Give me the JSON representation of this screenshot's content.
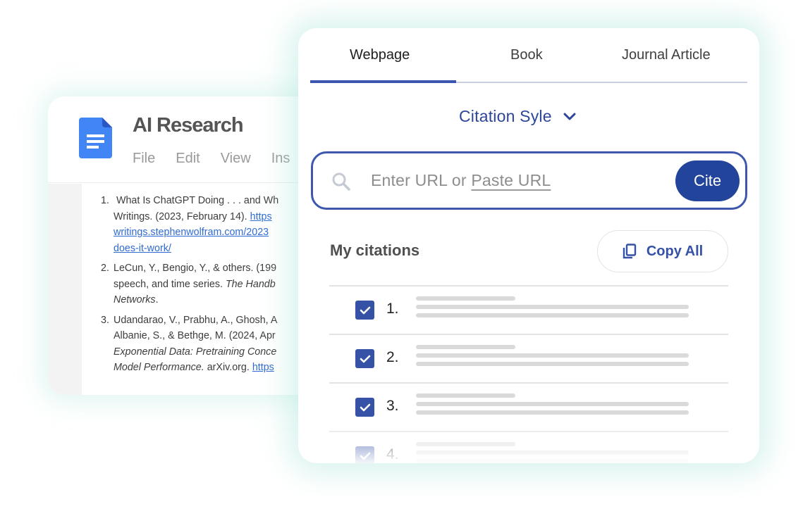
{
  "document": {
    "title": "AI Research",
    "menu": [
      "File",
      "Edit",
      "View",
      "Ins"
    ],
    "references": [
      {
        "number": "1.",
        "lines": [
          {
            "text": "What Is ChatGPT Doing . . . and Wh",
            "link": ""
          },
          {
            "text": "Writings. (2023, February 14). ",
            "link": "https"
          },
          {
            "text": "",
            "link": "writings.stephenwolfram.com/2023"
          },
          {
            "text": "",
            "link": "does-it-work/"
          }
        ]
      },
      {
        "number": "2.",
        "lines": [
          {
            "text": "LeCun, Y., Bengio, Y., & others. (199",
            "italic": ""
          },
          {
            "text": "speech, and time series. ",
            "italic": "The Handb"
          },
          {
            "text": "",
            "italic": "Networks",
            "after": "."
          }
        ]
      },
      {
        "number": "3.",
        "lines": [
          {
            "text": "Udandarao, V., Prabhu, A., Ghosh, A"
          },
          {
            "text": "Albanie, S., & Bethge, M. (2024, Apr"
          },
          {
            "italic": "Exponential Data: Pretraining Conce"
          },
          {
            "italic": "Model Performance.",
            "text": " arXiv.org. ",
            "link": "https"
          }
        ]
      }
    ]
  },
  "citation_panel": {
    "tabs": [
      {
        "label": "Webpage",
        "active": true
      },
      {
        "label": "Book",
        "active": false
      },
      {
        "label": "Journal Article",
        "active": false
      }
    ],
    "style_select_label": "Citation Syle",
    "search": {
      "placeholder_prefix": "Enter URL or ",
      "placeholder_link": "Paste URL",
      "button_label": "Cite"
    },
    "my_citations_label": "My citations",
    "copy_all_label": "Copy All",
    "citations": [
      {
        "number": "1.",
        "checked": true
      },
      {
        "number": "2.",
        "checked": true
      },
      {
        "number": "3.",
        "checked": true
      },
      {
        "number": "4.",
        "checked": true
      }
    ],
    "colors": {
      "accent": "#3552a6",
      "button": "#23449b",
      "link": "#2f6bd3",
      "glow": "#a8e4da"
    }
  }
}
